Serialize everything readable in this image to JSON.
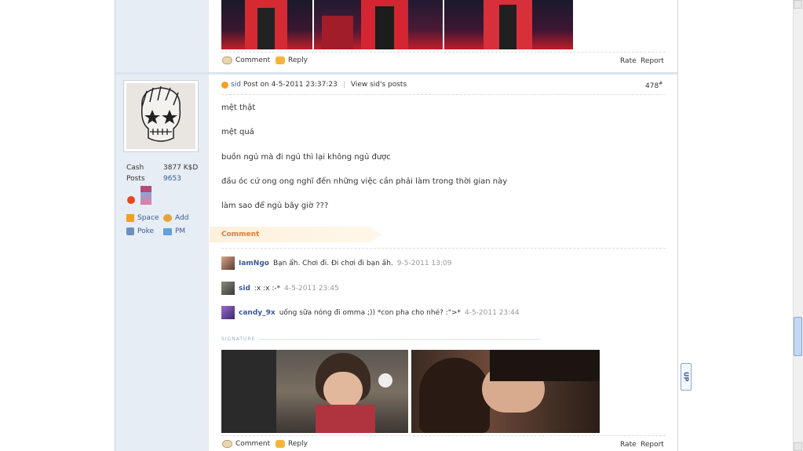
{
  "top_post": {
    "comment": "Comment",
    "reply": "Reply",
    "rate": "Rate",
    "report": "Report"
  },
  "user": {
    "cash_label": "Cash",
    "cash_value": "3877 K$D",
    "posts_label": "Posts",
    "posts_value": "9653",
    "space": "Space",
    "add": "Add",
    "poke": "Poke",
    "pm": "PM"
  },
  "post": {
    "author": "sid",
    "posted_on": "Post on 4-5-2011 23:37:23",
    "view_posts": "View sid's posts",
    "floor": "478",
    "floor_sup": "#",
    "lines": [
      "mệt thật",
      "mệt quá",
      "buồn ngủ mà đi ngủ thì lại không ngủ được",
      "đầu óc cứ ong ong nghĩ đến những việc cần phải làm trong thời gian này",
      "làm sao để ngủ bây giờ ???"
    ],
    "comment_header": "Comment",
    "comments": [
      {
        "user": "IamNgo",
        "text": "Bạn ấh. Chơi đi. Đi chơi đi bạn ấh.",
        "time": "9-5-2011 13:09"
      },
      {
        "user": "sid",
        "text": ":x :x :-*",
        "time": "4-5-2011 23:45"
      },
      {
        "user": "candy_9x",
        "text": "uống sữa nóng đi omma ;)) *con pha cho nhé? :\">*",
        "time": "4-5-2011 23:44"
      }
    ],
    "signature": "SIGNATURE",
    "actions": {
      "comment": "Comment",
      "reply": "Reply",
      "rate": "Rate",
      "report": "Report"
    }
  },
  "up_label": "UP"
}
